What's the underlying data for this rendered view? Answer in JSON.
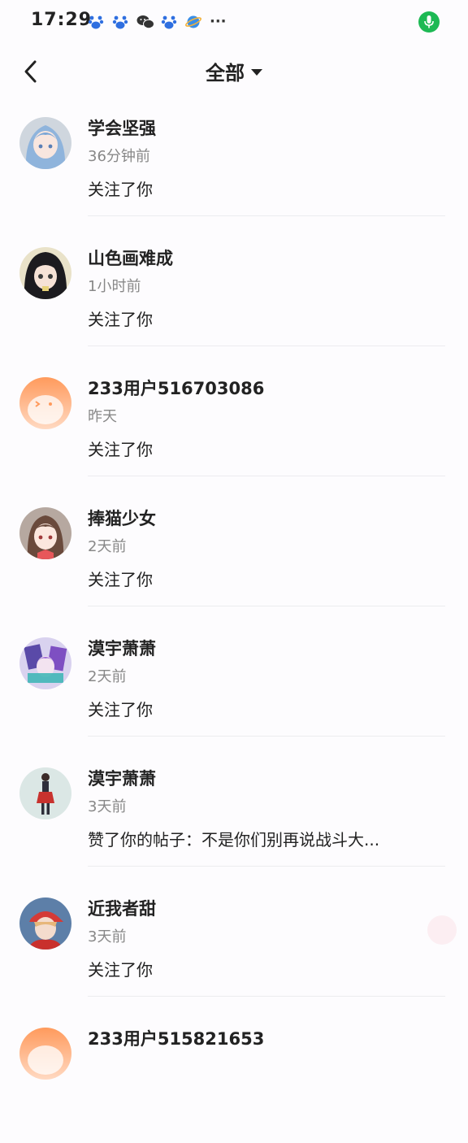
{
  "status_bar": {
    "time": "17:29",
    "icons": [
      "baidu-icon",
      "baidu-icon",
      "wechat-icon",
      "baidu-icon",
      "browser-icon",
      "more-icon"
    ],
    "more": "···",
    "mic_color": "#1db954"
  },
  "header": {
    "title": "全部"
  },
  "notifications": [
    {
      "name": "学会坚强",
      "time": "36分钟前",
      "action": "关注了你"
    },
    {
      "name": "山色画难成",
      "time": "1小时前",
      "action": "关注了你"
    },
    {
      "name": "233用户516703086",
      "time": "昨天",
      "action": "关注了你"
    },
    {
      "name": "捧猫少女",
      "time": "2天前",
      "action": "关注了你"
    },
    {
      "name": "漠宇萧萧",
      "time": "2天前",
      "action": "关注了你"
    },
    {
      "name": "漠宇萧萧",
      "time": "3天前",
      "action": "赞了你的帖子：不是你们别再说战斗大..."
    },
    {
      "name": "近我者甜",
      "time": "3天前",
      "action": "关注了你"
    },
    {
      "name": "233用户515821653",
      "time": "",
      "action": ""
    }
  ]
}
